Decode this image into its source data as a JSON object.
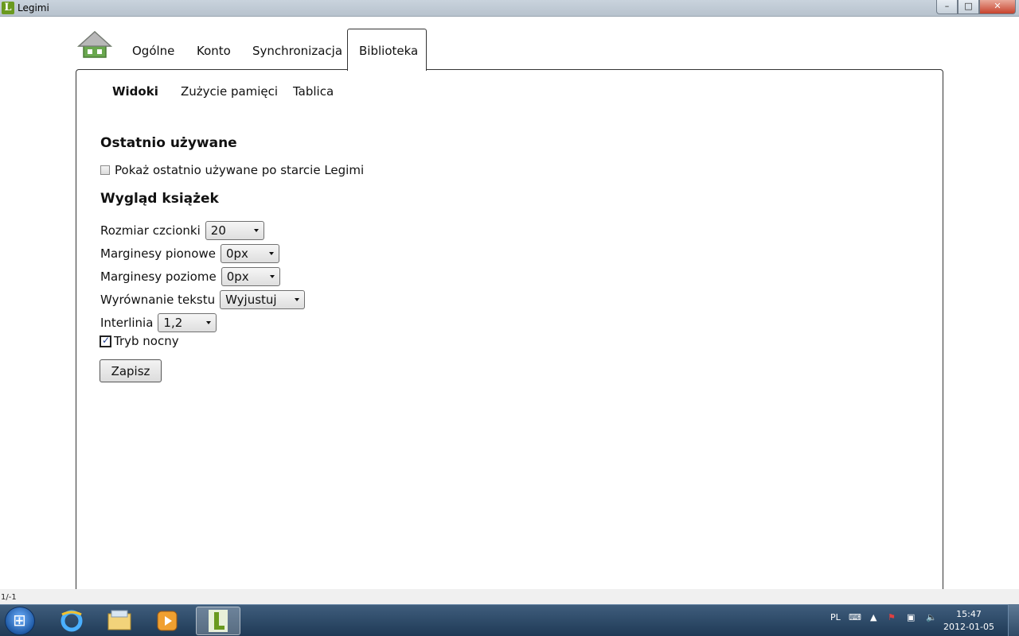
{
  "window": {
    "title": "Legimi",
    "app_icon_letter": "L",
    "minimize": "–",
    "maximize": "□",
    "close": "✕"
  },
  "top_tabs": [
    {
      "label": "Ogólne"
    },
    {
      "label": "Konto"
    },
    {
      "label": "Synchronizacja"
    },
    {
      "label": "Biblioteka",
      "active": true
    }
  ],
  "sub_tabs": [
    {
      "label": "Widoki",
      "active": true
    },
    {
      "label": "Zużycie pamięci"
    },
    {
      "label": "Tablica"
    }
  ],
  "recent": {
    "heading": "Ostatnio używane",
    "checkbox_label": "Pokaż ostatnio używane po starcie Legimi",
    "checked": false
  },
  "appearance": {
    "heading": "Wygląd książek",
    "font_size": {
      "label": "Rozmiar czcionki",
      "value": "20"
    },
    "vertical_margins": {
      "label": "Marginesy pionowe",
      "value": "0px"
    },
    "horizontal_margins": {
      "label": "Marginesy poziome",
      "value": "0px"
    },
    "text_align": {
      "label": "Wyrównanie tekstu",
      "value": "Wyjustuj"
    },
    "line_spacing": {
      "label": "Interlinia",
      "value": "1,2"
    },
    "night_mode": {
      "label": "Tryb nocny",
      "checked": true
    },
    "save_label": "Zapisz"
  },
  "statusbar": {
    "text": "1/-1"
  },
  "taskbar": {
    "language": "PL",
    "time": "15:47",
    "date": "2012-01-05"
  },
  "colors": {
    "accent": "#6a9a1f",
    "home_icon": "#5f9a3a"
  }
}
